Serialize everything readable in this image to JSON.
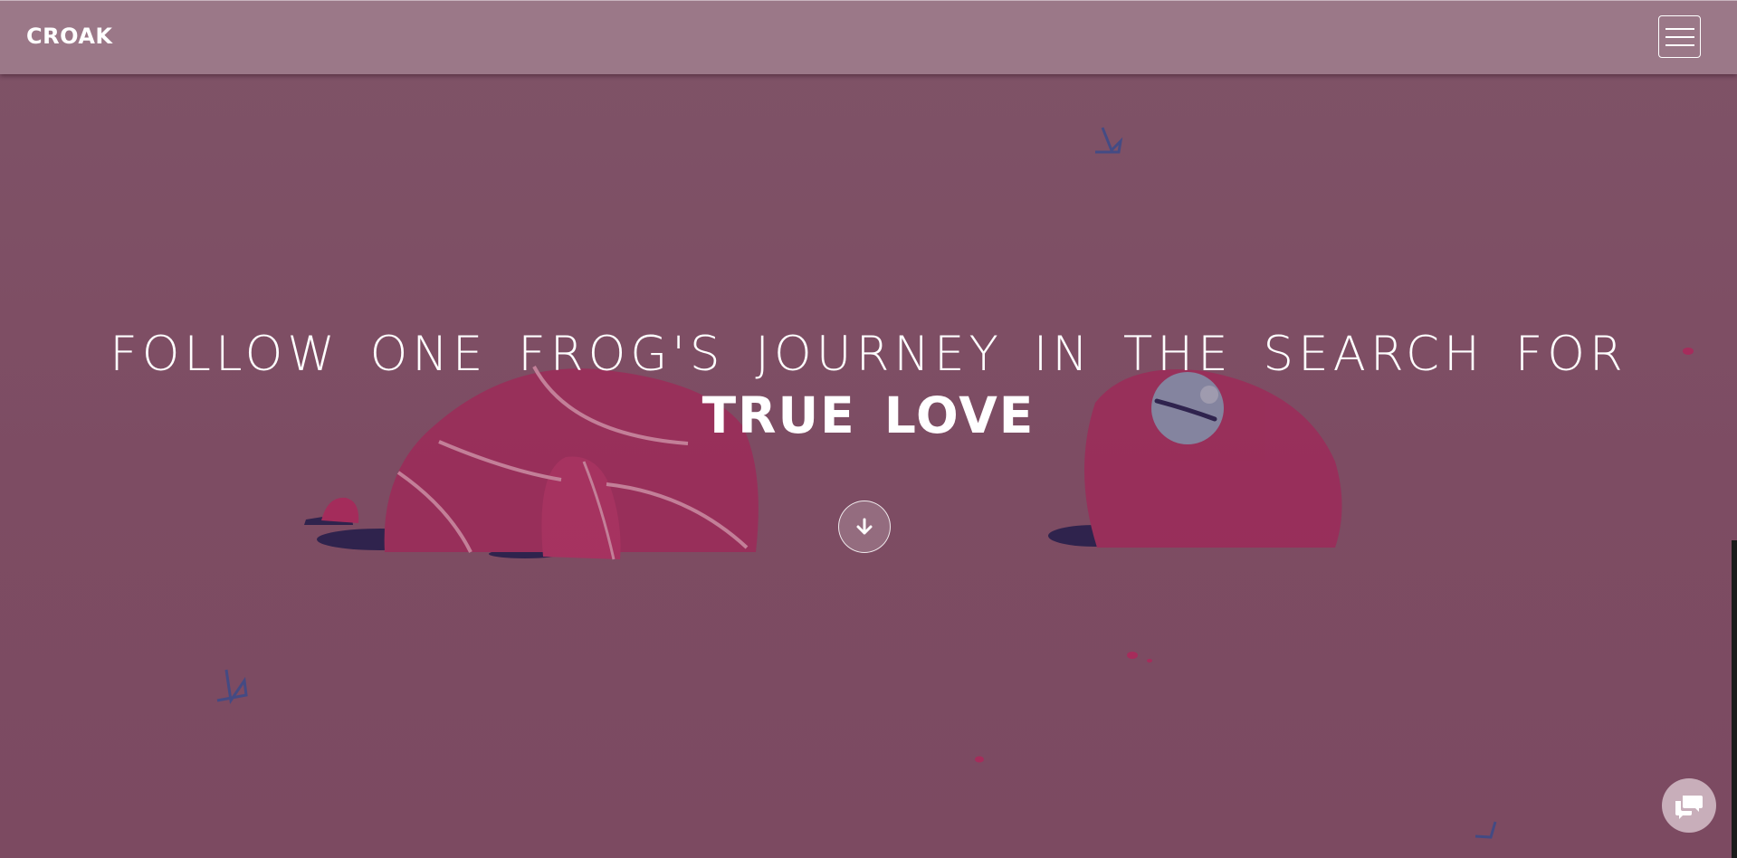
{
  "navbar": {
    "brand": "CROAK",
    "menu_icon": "hamburger-menu-icon"
  },
  "hero": {
    "line1": "FOLLOW ONE FROG'S JOURNEY IN THE SEARCH FOR",
    "line2": "TRUE LOVE",
    "scroll_icon": "arrow-down-icon"
  },
  "chat": {
    "icon": "chat-bubbles-icon"
  },
  "colors": {
    "background": "#7e4f66",
    "navbar": "#9b7888",
    "frog_body": "#8c2f55",
    "shadow": "#1a1848",
    "eye": "#8794b0",
    "reed": "#3a4a8a"
  }
}
